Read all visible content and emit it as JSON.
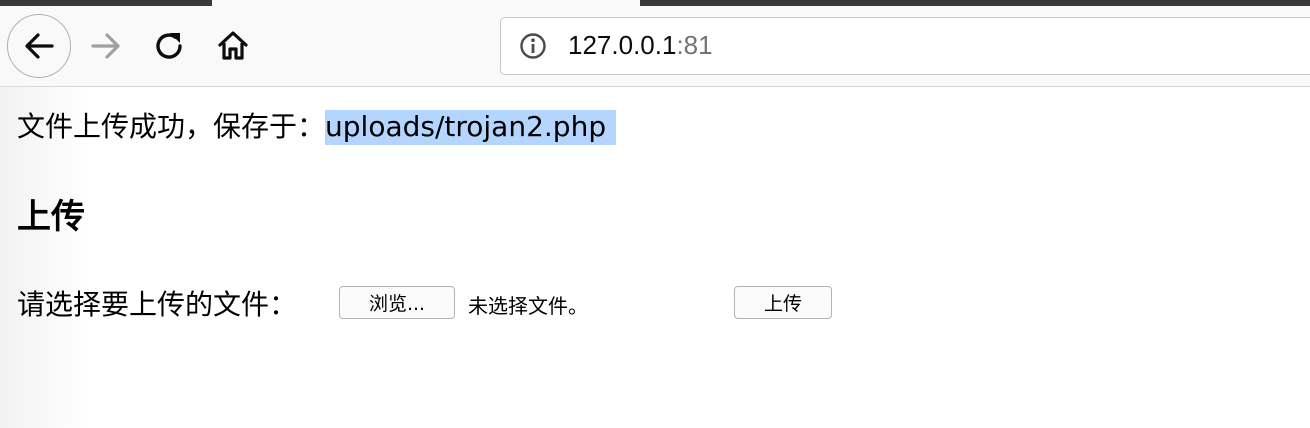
{
  "browser": {
    "url_host": "127.0.0.1",
    "url_port": ":81",
    "icons": {
      "back": "back-arrow-icon",
      "forward": "forward-arrow-icon",
      "reload": "reload-icon",
      "home": "home-icon",
      "site_info": "info-icon"
    }
  },
  "page": {
    "success_prefix": "文件上传成功，保存于：",
    "saved_path": "uploads/trojan2.php",
    "heading": "上传",
    "form_label": "请选择要上传的文件：",
    "browse_label": "浏览...",
    "no_file_label": "未选择文件。",
    "upload_label": "上传"
  },
  "colors": {
    "selection_highlight": "#b4d5fe",
    "toolbar_bg": "#f9f9fa"
  }
}
